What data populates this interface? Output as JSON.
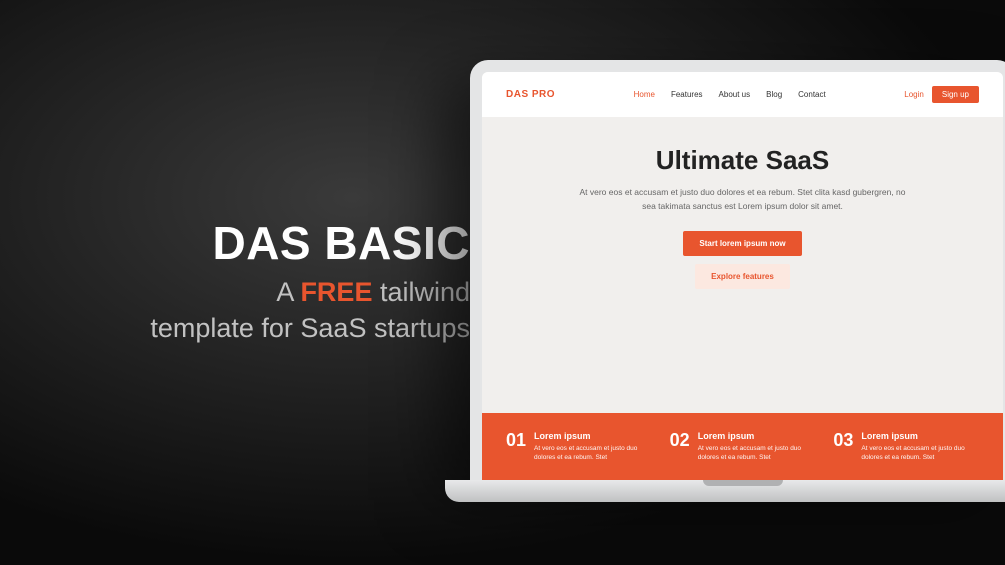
{
  "promo": {
    "heading": "DAS BASIC",
    "sub_prefix": "A ",
    "sub_accent": "FREE",
    "sub_mid": " tailwind",
    "sub_line2": "template for SaaS startups"
  },
  "site": {
    "logo": "DAS PRO",
    "nav": {
      "home": "Home",
      "features": "Features",
      "about": "About us",
      "blog": "Blog",
      "contact": "Contact"
    },
    "auth": {
      "login": "Login",
      "signup": "Sign up"
    },
    "hero": {
      "title": "Ultimate SaaS",
      "desc": "At vero eos et accusam et justo duo dolores et ea rebum. Stet clita kasd gubergren, no sea takimata sanctus est Lorem ipsum dolor sit amet.",
      "cta_primary": "Start lorem ipsum now",
      "cta_secondary": "Explore features"
    },
    "features": [
      {
        "num": "01",
        "title": "Lorem ipsum",
        "desc": "At vero eos et accusam et justo duo dolores et ea rebum. Stet"
      },
      {
        "num": "02",
        "title": "Lorem ipsum",
        "desc": "At vero eos et accusam et justo duo dolores et ea rebum. Stet"
      },
      {
        "num": "03",
        "title": "Lorem ipsum",
        "desc": "At vero eos et accusam et justo duo dolores et ea rebum. Stet"
      }
    ]
  }
}
